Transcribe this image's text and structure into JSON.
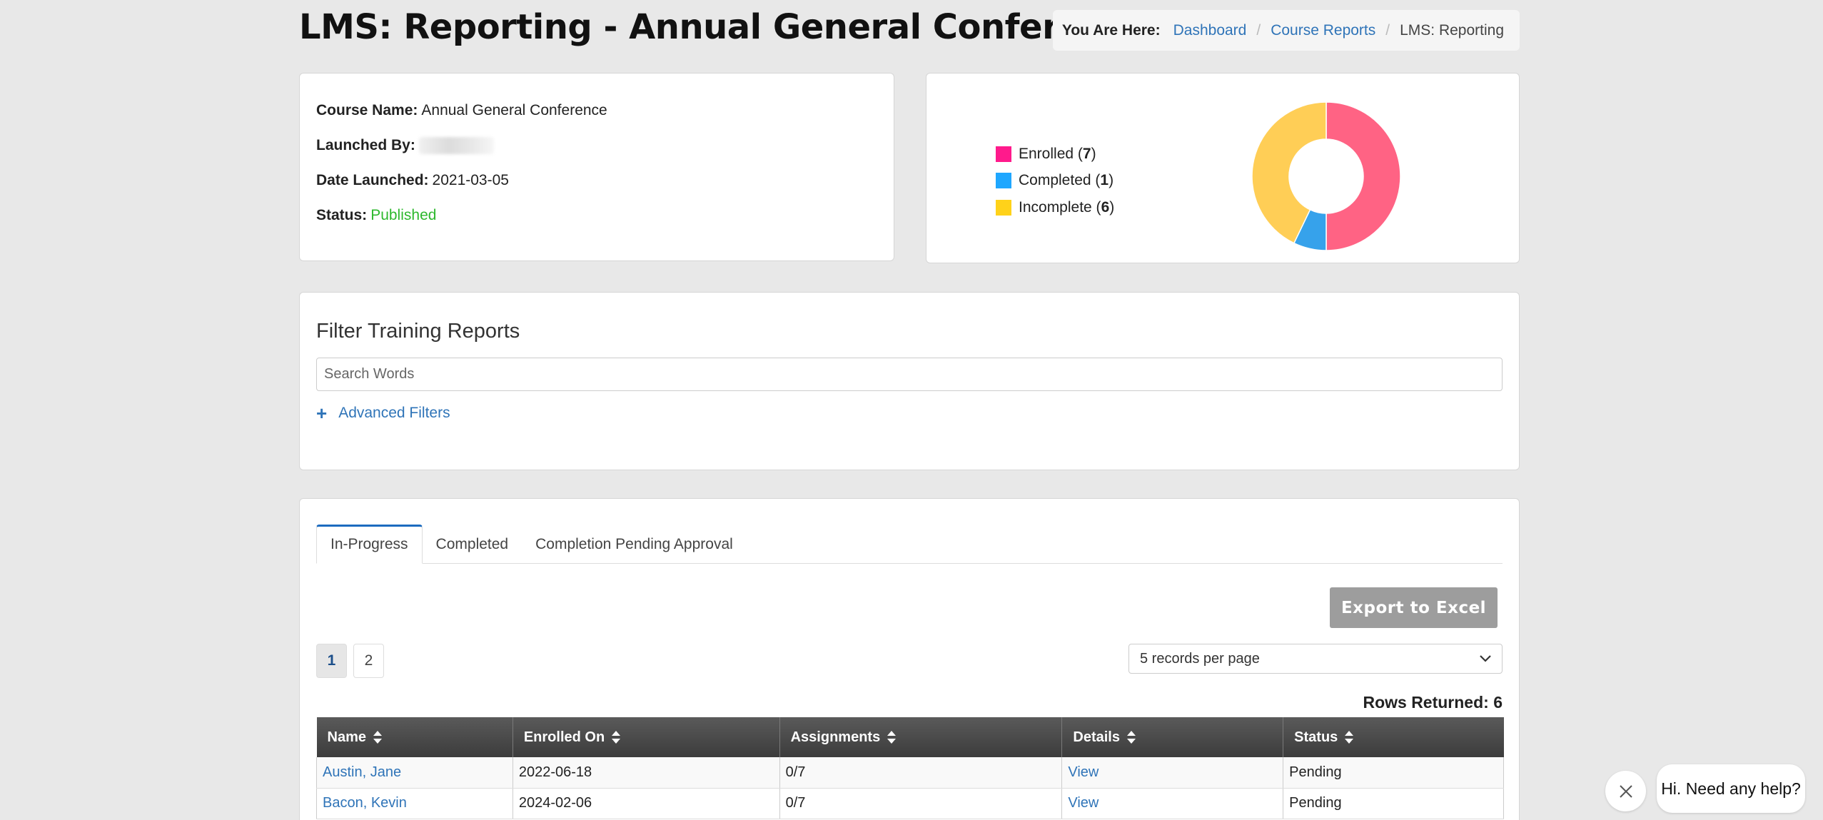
{
  "page_title": "LMS: Reporting - Annual General Conference",
  "breadcrumb": {
    "lead": "You Are Here:",
    "items": [
      "Dashboard",
      "Course Reports",
      "LMS: Reporting"
    ]
  },
  "course_info": {
    "course_name_label": "Course Name:",
    "course_name": "Annual General Conference",
    "launched_by_label": "Launched By:",
    "date_launched_label": "Date Launched:",
    "date_launched": "2021-03-05",
    "status_label": "Status:",
    "status": "Published"
  },
  "chart_data": {
    "type": "pie",
    "categories": [
      "Enrolled",
      "Completed",
      "Incomplete"
    ],
    "values": [
      7,
      1,
      6
    ],
    "colors": [
      "#ff6384",
      "#36a2eb",
      "#ffce56"
    ],
    "legend_colors": [
      "#ff1a8c",
      "#1fa7ff",
      "#ffd21a"
    ],
    "legend_placement": "left",
    "donut": true
  },
  "filter": {
    "title": "Filter Training Reports",
    "search_placeholder": "Search Words",
    "advanced_label": "Advanced Filters"
  },
  "tabs": [
    {
      "label": "In-Progress",
      "active": true
    },
    {
      "label": "Completed",
      "active": false
    },
    {
      "label": "Completion Pending Approval",
      "active": false
    }
  ],
  "export_label": "Export to Excel",
  "pagination": {
    "pages": [
      "1",
      "2"
    ],
    "current": "1"
  },
  "per_page": "5 records per page",
  "rows_returned": "Rows Returned: 6",
  "table": {
    "columns": [
      "Name",
      "Enrolled On",
      "Assignments",
      "Details",
      "Status"
    ],
    "rows": [
      {
        "name": "Austin, Jane",
        "enrolled_on": "2022-06-18",
        "assignments": "0/7",
        "details": "View",
        "status": "Pending"
      },
      {
        "name": "Bacon, Kevin",
        "enrolled_on": "2024-02-06",
        "assignments": "0/7",
        "details": "View",
        "status": "Pending"
      }
    ]
  },
  "chat": {
    "message": "Hi. Need any help?"
  }
}
